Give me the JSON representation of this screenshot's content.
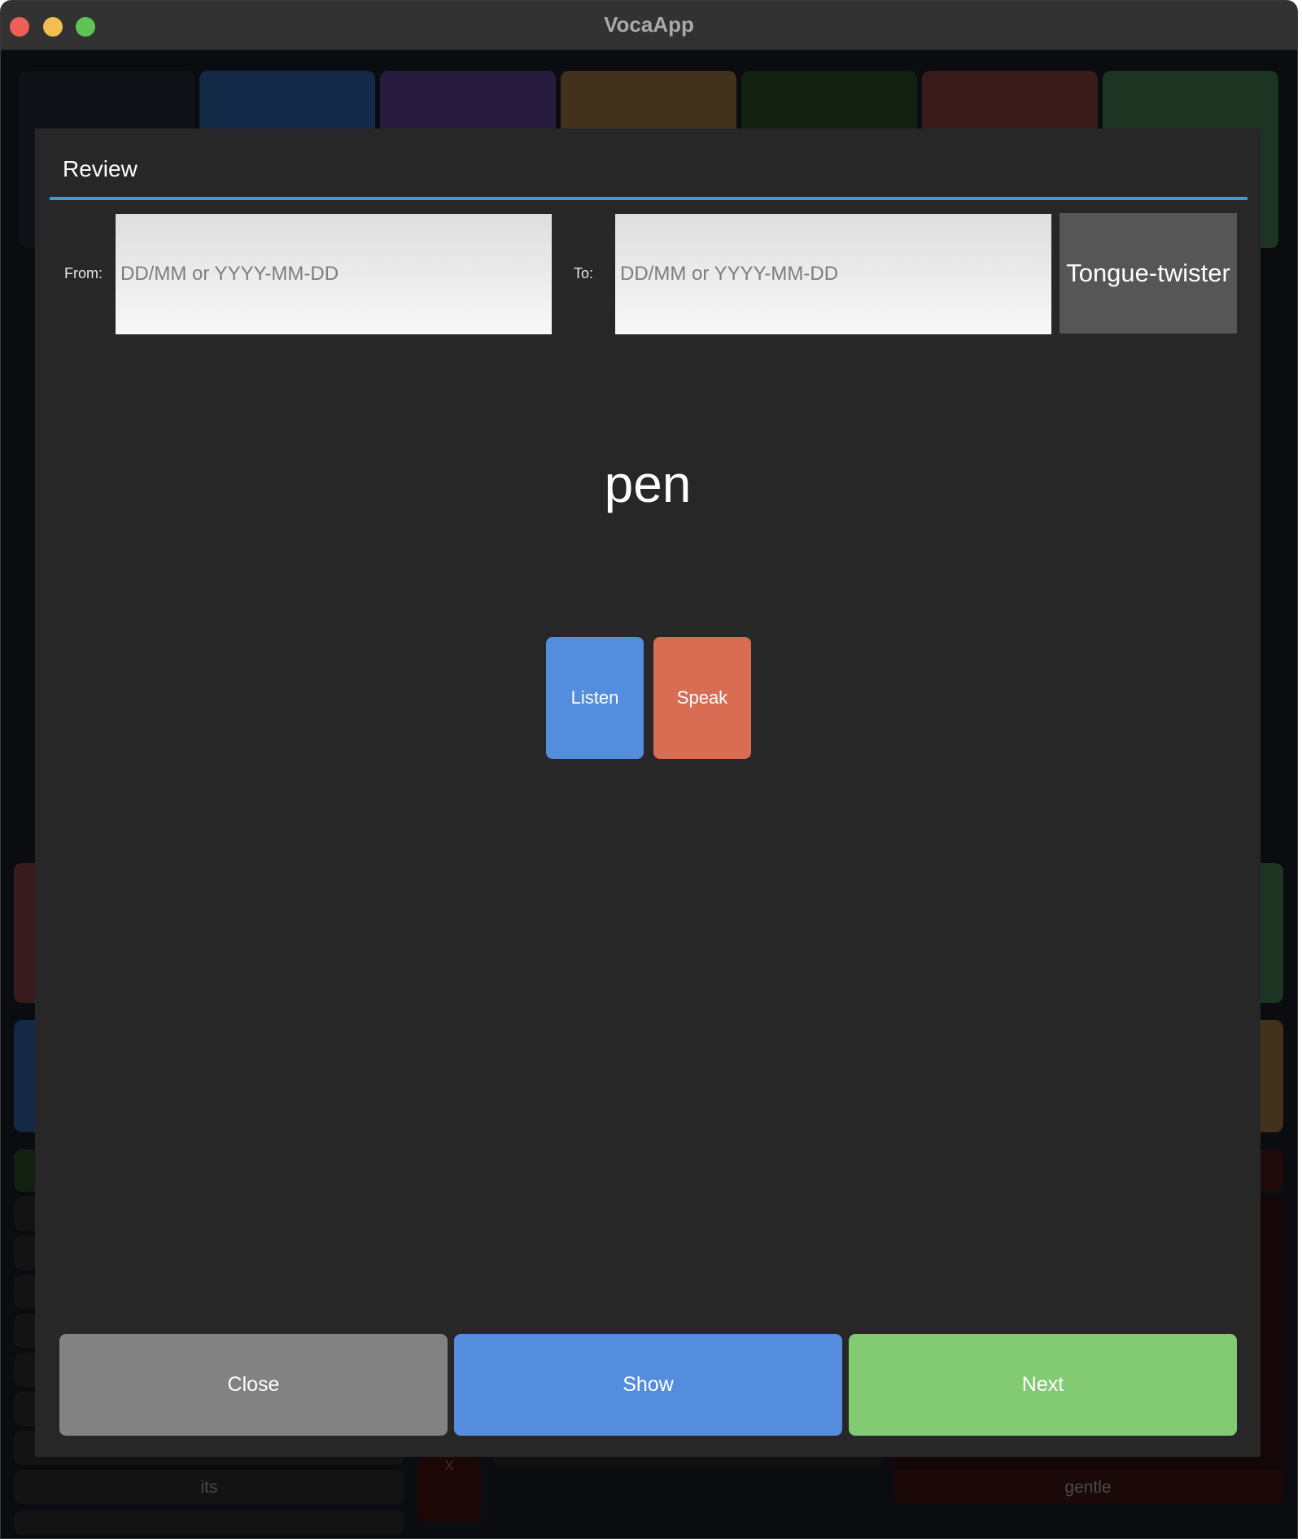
{
  "window": {
    "title": "VocaApp"
  },
  "background": {
    "category_colors": [
      "#0f1216",
      "#142847",
      "#271c3d",
      "#43321b",
      "#12200f",
      "#3a1b1c",
      "#1e3422"
    ],
    "words": [
      "its",
      "gentle",
      "x"
    ]
  },
  "dialog": {
    "title": "Review",
    "from_label": "From:",
    "to_label": "To:",
    "from_placeholder": "DD/MM or YYYY-MM-DD",
    "to_placeholder": "DD/MM or YYYY-MM-DD",
    "tongue_twister_label": "Tongue-twister",
    "word": "pen",
    "listen_label": "Listen",
    "speak_label": "Speak",
    "close_label": "Close",
    "show_label": "Show",
    "next_label": "Next"
  },
  "colors": {
    "accent_line": "#4d95c7",
    "listen": "#548ddd",
    "speak": "#d86d54",
    "close": "#828282",
    "show": "#548ddd",
    "next": "#82cb72"
  }
}
